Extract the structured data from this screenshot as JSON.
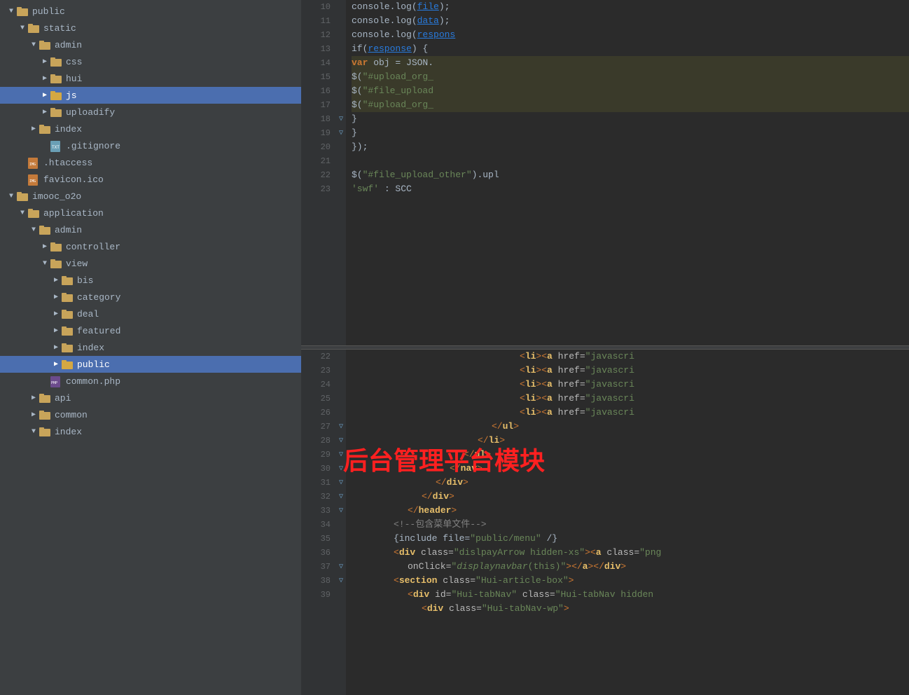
{
  "fileTree": {
    "items": [
      {
        "id": "public",
        "label": "public",
        "type": "folder",
        "indent": 0,
        "expanded": true,
        "arrow": "▼"
      },
      {
        "id": "static",
        "label": "static",
        "type": "folder",
        "indent": 1,
        "expanded": true,
        "arrow": "▼"
      },
      {
        "id": "admin-static",
        "label": "admin",
        "type": "folder",
        "indent": 2,
        "expanded": true,
        "arrow": "▼"
      },
      {
        "id": "css",
        "label": "css",
        "type": "folder",
        "indent": 3,
        "expanded": false,
        "arrow": "▶"
      },
      {
        "id": "hui",
        "label": "hui",
        "type": "folder",
        "indent": 3,
        "expanded": false,
        "arrow": "▶"
      },
      {
        "id": "js",
        "label": "js",
        "type": "folder",
        "indent": 3,
        "expanded": false,
        "arrow": "▶",
        "selected": true
      },
      {
        "id": "uploadify",
        "label": "uploadify",
        "type": "folder",
        "indent": 3,
        "expanded": false,
        "arrow": "▶"
      },
      {
        "id": "index-static",
        "label": "index",
        "type": "folder",
        "indent": 2,
        "expanded": false,
        "arrow": "▶"
      },
      {
        "id": "gitignore",
        "label": ".gitignore",
        "type": "file-text",
        "indent": 2
      },
      {
        "id": "htaccess",
        "label": ".htaccess",
        "type": "file-img",
        "indent": 1
      },
      {
        "id": "favicon",
        "label": "favicon.ico",
        "type": "file-img",
        "indent": 1
      },
      {
        "id": "imooc_o2o",
        "label": "imooc_o2o",
        "type": "folder",
        "indent": 0,
        "expanded": true,
        "arrow": "▼"
      },
      {
        "id": "application",
        "label": "application",
        "type": "folder",
        "indent": 1,
        "expanded": true,
        "arrow": "▼"
      },
      {
        "id": "admin-app",
        "label": "admin",
        "type": "folder",
        "indent": 2,
        "expanded": true,
        "arrow": "▼"
      },
      {
        "id": "controller",
        "label": "controller",
        "type": "folder",
        "indent": 3,
        "expanded": false,
        "arrow": "▶"
      },
      {
        "id": "view",
        "label": "view",
        "type": "folder",
        "indent": 3,
        "expanded": true,
        "arrow": "▼"
      },
      {
        "id": "bis",
        "label": "bis",
        "type": "folder",
        "indent": 4,
        "expanded": false,
        "arrow": "▶"
      },
      {
        "id": "category",
        "label": "category",
        "type": "folder",
        "indent": 4,
        "expanded": false,
        "arrow": "▶"
      },
      {
        "id": "deal",
        "label": "deal",
        "type": "folder",
        "indent": 4,
        "expanded": false,
        "arrow": "▶"
      },
      {
        "id": "featured",
        "label": "featured",
        "type": "folder",
        "indent": 4,
        "expanded": false,
        "arrow": "▶"
      },
      {
        "id": "index-view",
        "label": "index",
        "type": "folder",
        "indent": 4,
        "expanded": false,
        "arrow": "▶"
      },
      {
        "id": "public-app",
        "label": "public",
        "type": "folder",
        "indent": 4,
        "expanded": false,
        "arrow": "▶",
        "selected": true
      },
      {
        "id": "common-php",
        "label": "common.php",
        "type": "file-php",
        "indent": 3
      },
      {
        "id": "api",
        "label": "api",
        "type": "folder",
        "indent": 2,
        "expanded": false,
        "arrow": "▶"
      },
      {
        "id": "common",
        "label": "common",
        "type": "folder",
        "indent": 2,
        "expanded": false,
        "arrow": "▶"
      },
      {
        "id": "index-app",
        "label": "index",
        "type": "folder",
        "indent": 2,
        "expanded": true,
        "arrow": "▼"
      }
    ]
  },
  "codeTop": {
    "lines": [
      {
        "num": 10,
        "content": "console_log_file",
        "raw": "            console.log(<u>file</u>);"
      },
      {
        "num": 11,
        "content": "console_log_data",
        "raw": "            console.log(<u>data</u>);"
      },
      {
        "num": 12,
        "content": "console_log_response",
        "raw": "            console.log(<u>respons</u>"
      },
      {
        "num": 13,
        "content": "if_response",
        "raw": "            if(<u>response</u>) {"
      },
      {
        "num": 14,
        "content": "var_obj",
        "raw": "                <b>var</b> obj = JSON."
      },
      {
        "num": 15,
        "content": "upload_org1",
        "raw": "                $(\"#upload_org_"
      },
      {
        "num": 16,
        "content": "file_upload",
        "raw": "                $(\"#file_upload"
      },
      {
        "num": 17,
        "content": "upload_org2",
        "raw": "                $(\"#upload_org_"
      },
      {
        "num": 18,
        "content": "close_brace",
        "raw": "            }"
      },
      {
        "num": 19,
        "content": "close_brace2",
        "raw": "        }"
      },
      {
        "num": 20,
        "content": "close_paren",
        "raw": "    });"
      },
      {
        "num": 21,
        "content": "empty",
        "raw": ""
      },
      {
        "num": 22,
        "content": "file_upload_other",
        "raw": "    $(\"#file_upload_other\").upl"
      },
      {
        "num": 23,
        "content": "swf",
        "raw": "        'swf'                 : SCC"
      }
    ]
  },
  "codeBottom": {
    "lines": [
      {
        "num": 22,
        "content": "li_a_22",
        "gutter": false
      },
      {
        "num": 23,
        "content": "li_a_23",
        "gutter": false
      },
      {
        "num": 24,
        "content": "li_a_24",
        "gutter": false
      },
      {
        "num": 25,
        "content": "li_a_25",
        "gutter": false
      },
      {
        "num": 26,
        "content": "li_a_26",
        "gutter": false
      },
      {
        "num": 27,
        "content": "ul_close",
        "gutter": true
      },
      {
        "num": 28,
        "content": "li_close",
        "gutter": true
      },
      {
        "num": 29,
        "content": "ul_close2",
        "gutter": true
      },
      {
        "num": 30,
        "content": "nav_close",
        "gutter": true
      },
      {
        "num": 31,
        "content": "div_close",
        "gutter": true
      },
      {
        "num": 32,
        "content": "div_close2",
        "gutter": true
      },
      {
        "num": 33,
        "content": "header_close",
        "gutter": true
      },
      {
        "num": 34,
        "content": "comment",
        "gutter": false
      },
      {
        "num": 35,
        "content": "include",
        "gutter": false
      },
      {
        "num": 36,
        "content": "div_display",
        "gutter": false
      },
      {
        "num": 37,
        "content": "section",
        "gutter": true
      },
      {
        "num": 38,
        "content": "div_hui",
        "gutter": true
      },
      {
        "num": 39,
        "content": "div_hui_wp",
        "gutter": false
      }
    ]
  },
  "overlayText": "后台管理平台模块"
}
